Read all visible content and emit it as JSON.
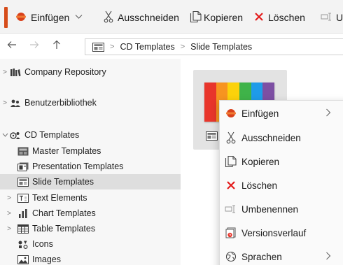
{
  "toolbar": {
    "items": [
      {
        "label": "Einfügen",
        "icon": "paste-icon"
      },
      {
        "label": "Ausschneiden",
        "icon": "scissors-icon"
      },
      {
        "label": "Kopieren",
        "icon": "copy-icon"
      },
      {
        "label": "Löschen",
        "icon": "delete-x-icon"
      },
      {
        "label": "U",
        "icon": "rename-icon"
      }
    ],
    "accent_color": "#d64c1a"
  },
  "addressbar": {
    "path": [
      "CD Templates",
      "Slide Templates"
    ]
  },
  "sidebar": {
    "items": [
      {
        "label": "Company Repository",
        "icon": "library-icon",
        "expander": "collapsed"
      },
      {
        "label": "Benutzerbibliothek",
        "icon": "users-icon",
        "expander": "collapsed"
      },
      {
        "label": "CD Templates",
        "icon": "cd-templates-icon",
        "expander": "expanded"
      },
      {
        "label": "Master Templates",
        "icon": "master-template-icon",
        "expander": "none"
      },
      {
        "label": "Presentation Templates",
        "icon": "presentation-icon",
        "expander": "none"
      },
      {
        "label": "Slide Templates",
        "icon": "slide-template-icon",
        "expander": "none",
        "selected": true
      },
      {
        "label": "Text Elements",
        "icon": "text-elements-icon",
        "expander": "collapsed"
      },
      {
        "label": "Chart Templates",
        "icon": "chart-icon",
        "expander": "collapsed"
      },
      {
        "label": "Table Templates",
        "icon": "table-icon",
        "expander": "collapsed"
      },
      {
        "label": "Icons",
        "icon": "icons-icon",
        "expander": "none"
      },
      {
        "label": "Images",
        "icon": "image-icon",
        "expander": "none"
      }
    ]
  },
  "content": {
    "thumbnail_colors": [
      "#e8352b",
      "#f79420",
      "#fcd20b",
      "#3fb349",
      "#1e9be9",
      "#7d4fa3"
    ]
  },
  "context_menu": {
    "items": [
      {
        "label": "Einfügen",
        "icon": "paste-icon",
        "submenu": true
      },
      {
        "label": "Ausschneiden",
        "icon": "scissors-icon",
        "submenu": false
      },
      {
        "label": "Kopieren",
        "icon": "copy-icon",
        "submenu": false
      },
      {
        "label": "Löschen",
        "icon": "delete-x-icon",
        "submenu": false
      },
      {
        "label": "Umbenennen",
        "icon": "rename-icon",
        "submenu": false
      },
      {
        "label": "Versionsverlauf",
        "icon": "version-history-icon",
        "submenu": false
      },
      {
        "label": "Sprachen",
        "icon": "globe-icon",
        "submenu": true
      }
    ]
  }
}
